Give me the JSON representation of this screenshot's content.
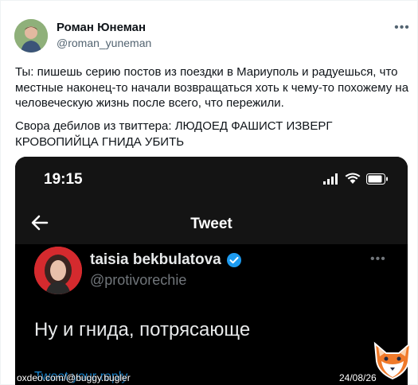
{
  "tweet": {
    "author_name": "Роман Юнеман",
    "author_handle": "@roman_yuneman",
    "more_icon": "•••",
    "paragraph1": "Ты: пишешь серию постов из поездки в Мариуполь и радуешься, что местные наконец-то начали возвращаться хоть к чему-то похожему на человеческую жизнь после всего, что пережили.",
    "paragraph2": "Свора дебилов из твиттера: ЛЮДОЕД ФАШИСТ ИЗВЕРГ КРОВОПИЙЦА ГНИДА УБИТЬ"
  },
  "screenshot": {
    "time": "19:15",
    "header_title": "Tweet",
    "author_name": "taisia bekbulatova",
    "author_handle": "@protivorechie",
    "more_icon": "•••",
    "text": "Ну и гнида, потрясающе",
    "bottom_link": "Tweet your reply"
  },
  "watermark": {
    "left_text": "oxdeo.com/@buggy.bugler",
    "date": "24/08/26"
  },
  "colors": {
    "verified": "#1d9bf0",
    "handle": "#536471",
    "dark_bg": "#000000"
  }
}
